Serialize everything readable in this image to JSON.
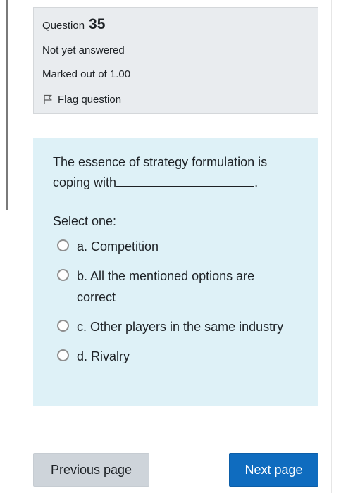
{
  "question_info": {
    "question_label": "Question",
    "question_number": "35",
    "status": "Not yet answered",
    "marks": "Marked out of 1.00",
    "flag_label": "Flag question"
  },
  "question": {
    "stem_before_blank": "The essence of strategy formulation is coping with",
    "stem_after_blank": ".",
    "prompt": "Select one:",
    "options": [
      "a. Competition",
      "b. All the mentioned options are correct",
      "c. Other players in the same industry",
      "d. Rivalry"
    ]
  },
  "navigation": {
    "previous_label": "Previous page",
    "next_label": "Next page"
  },
  "colors": {
    "info_background": "#e9ecef",
    "question_background": "#def1f7",
    "primary_button": "#0f6cbf",
    "secondary_button": "#ced4da"
  },
  "icons": {
    "flag": "flag-icon"
  }
}
